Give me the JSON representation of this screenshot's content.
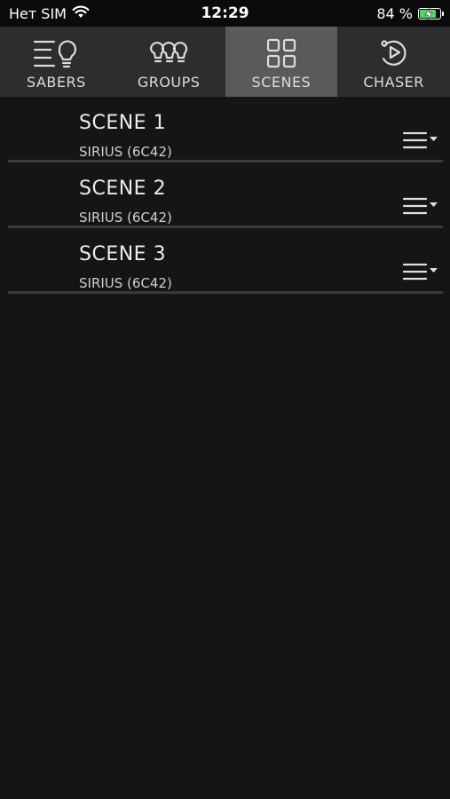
{
  "status_bar": {
    "carrier": "Нет SIM",
    "time": "12:29",
    "battery_percent": "84 %",
    "battery_level": 0.84
  },
  "tabs": [
    {
      "label": "SABERS",
      "icon": "sabers-icon",
      "active": false
    },
    {
      "label": "GROUPS",
      "icon": "groups-icon",
      "active": false
    },
    {
      "label": "SCENES",
      "icon": "scenes-icon",
      "active": true
    },
    {
      "label": "CHASER",
      "icon": "chaser-icon",
      "active": false
    }
  ],
  "scenes": [
    {
      "title": "SCENE 1",
      "subtitle": "SIRIUS (6C42)"
    },
    {
      "title": "SCENE 2",
      "subtitle": "SIRIUS (6C42)"
    },
    {
      "title": "SCENE 3",
      "subtitle": "SIRIUS (6C42)"
    }
  ],
  "colors": {
    "background": "#151515",
    "tab_bar": "#2d2d2d",
    "tab_active": "#5a5a5a",
    "battery_fill": "#4cd964"
  }
}
